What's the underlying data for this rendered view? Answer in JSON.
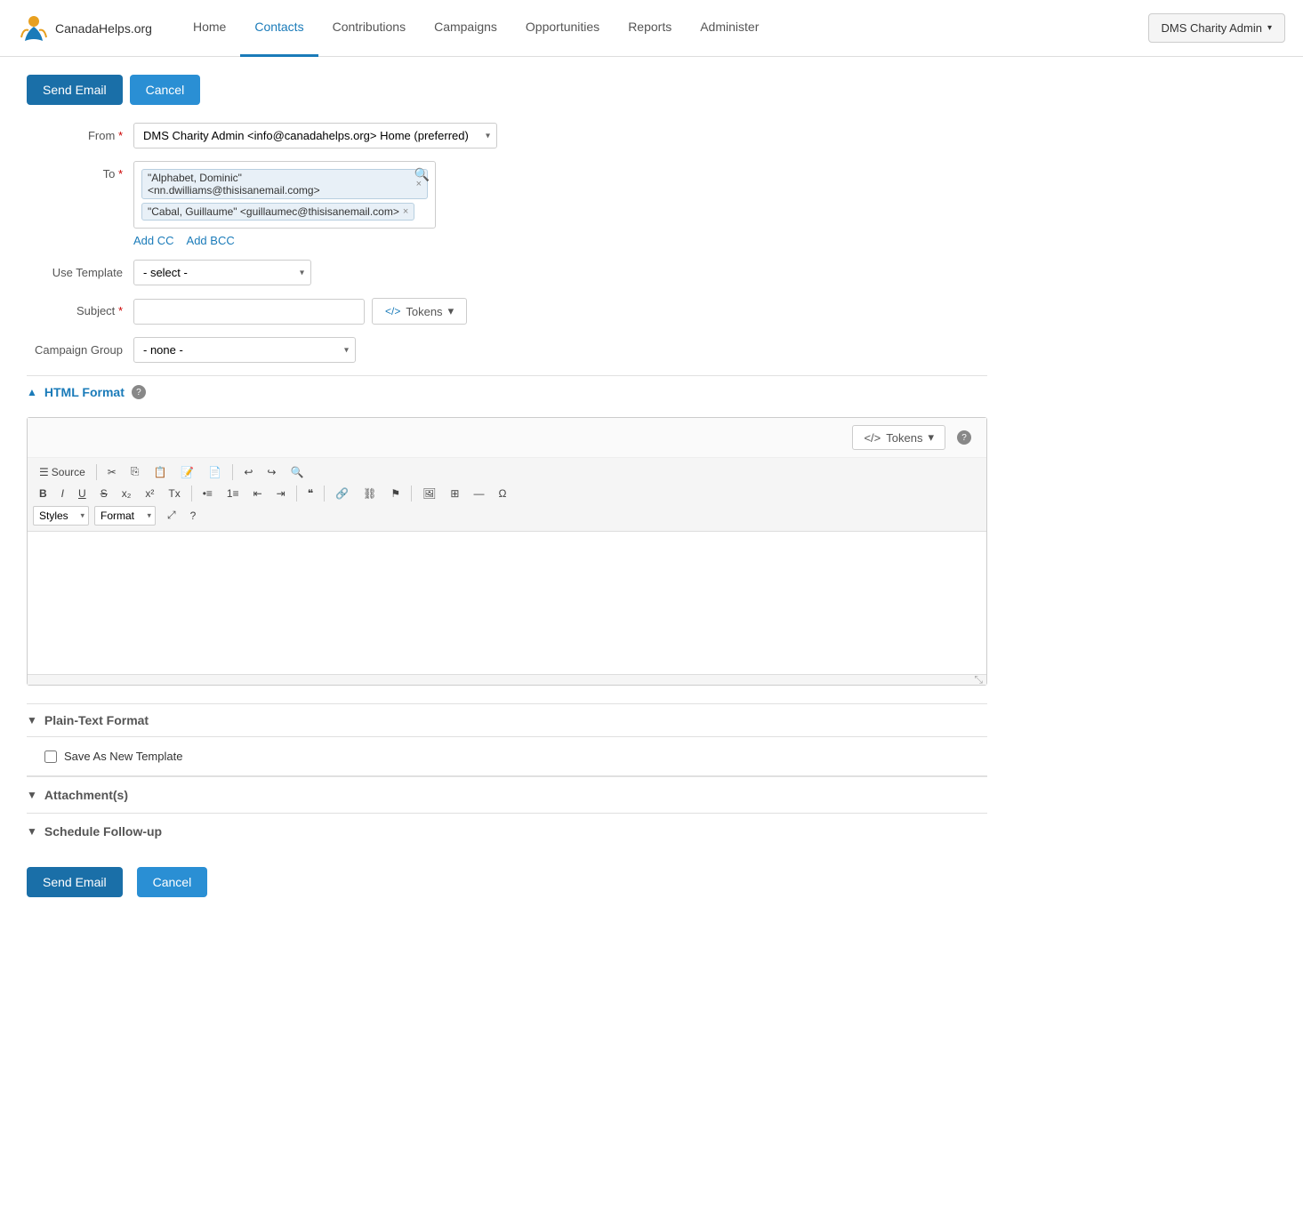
{
  "brand": {
    "name": "CanadaHelps.org"
  },
  "navbar": {
    "links": [
      {
        "id": "home",
        "label": "Home",
        "active": false
      },
      {
        "id": "contacts",
        "label": "Contacts",
        "active": true
      },
      {
        "id": "contributions",
        "label": "Contributions",
        "active": false
      },
      {
        "id": "campaigns",
        "label": "Campaigns",
        "active": false
      },
      {
        "id": "opportunities",
        "label": "Opportunities",
        "active": false
      },
      {
        "id": "reports",
        "label": "Reports",
        "active": false
      },
      {
        "id": "administer",
        "label": "Administer",
        "active": false
      }
    ],
    "admin_button": "DMS Charity Admin"
  },
  "page": {
    "send_email_btn": "Send Email",
    "cancel_btn": "Cancel"
  },
  "form": {
    "from_label": "From",
    "from_value": "DMS Charity Admin <info@canadahelps.org> Home (preferred)",
    "to_label": "To",
    "to_tags": [
      {
        "label": "\"Alphabet, Dominic\" <nn.dwilliams@thisisanemail.comg>"
      },
      {
        "label": "\"Cabal, Guillaume\" <guillaumec@thisisanemail.com>"
      }
    ],
    "add_cc": "Add CC",
    "add_bcc": "Add BCC",
    "use_template_label": "Use Template",
    "use_template_placeholder": "- select -",
    "subject_label": "Subject",
    "tokens_btn": "Tokens",
    "campaign_group_label": "Campaign Group",
    "campaign_group_value": "- none -",
    "html_format_title": "HTML Format",
    "tokens_bar_btn": "Tokens",
    "source_btn": "Source",
    "format_label": "Format",
    "styles_label": "Styles",
    "plain_text_format_title": "Plain-Text Format",
    "save_template_label": "Save As New Template",
    "attachments_title": "Attachment(s)",
    "schedule_title": "Schedule Follow-up"
  },
  "toolbar": {
    "source": "Source",
    "bold": "B",
    "italic": "I",
    "underline": "U",
    "strikethrough": "S",
    "subscript": "x₂",
    "superscript": "x²",
    "remove_format": "Tx",
    "bullet_list": "≡",
    "numbered_list": "≡",
    "indent_decrease": "←",
    "indent_increase": "→",
    "blockquote": "❝",
    "link": "🔗",
    "unlink": "⛓",
    "anchor": "⚑",
    "image": "🖼",
    "table": "⊞",
    "horizontal_rule": "—",
    "special_char": "Ω",
    "maximize": "⤢",
    "help": "?"
  },
  "colors": {
    "primary": "#1a6fa8",
    "nav_active": "#1a7bb9",
    "link": "#1a7bb9"
  }
}
